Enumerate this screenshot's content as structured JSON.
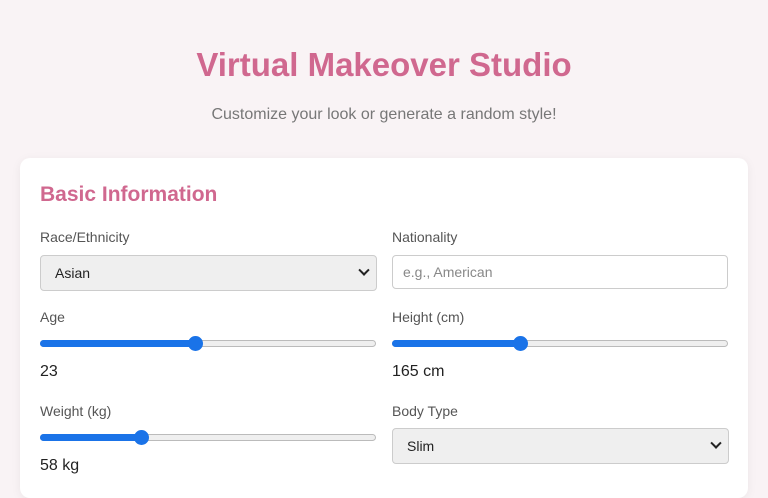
{
  "header": {
    "title": "Virtual Makeover Studio",
    "subtitle": "Customize your look or generate a random style!"
  },
  "basic_info": {
    "section_title": "Basic Information",
    "race": {
      "label": "Race/Ethnicity",
      "selected": "Asian"
    },
    "nationality": {
      "label": "Nationality",
      "value": "",
      "placeholder": "e.g., American"
    },
    "age": {
      "label": "Age",
      "value_text": "23",
      "fill_fraction": 0.46
    },
    "height": {
      "label": "Height (cm)",
      "value_text": "165 cm",
      "fill_fraction": 0.38
    },
    "weight": {
      "label": "Weight (kg)",
      "value_text": "58 kg",
      "fill_fraction": 0.3
    },
    "body_type": {
      "label": "Body Type",
      "selected": "Slim"
    }
  },
  "colors": {
    "accent": "#d0688f",
    "slider": "#1a73e8"
  }
}
